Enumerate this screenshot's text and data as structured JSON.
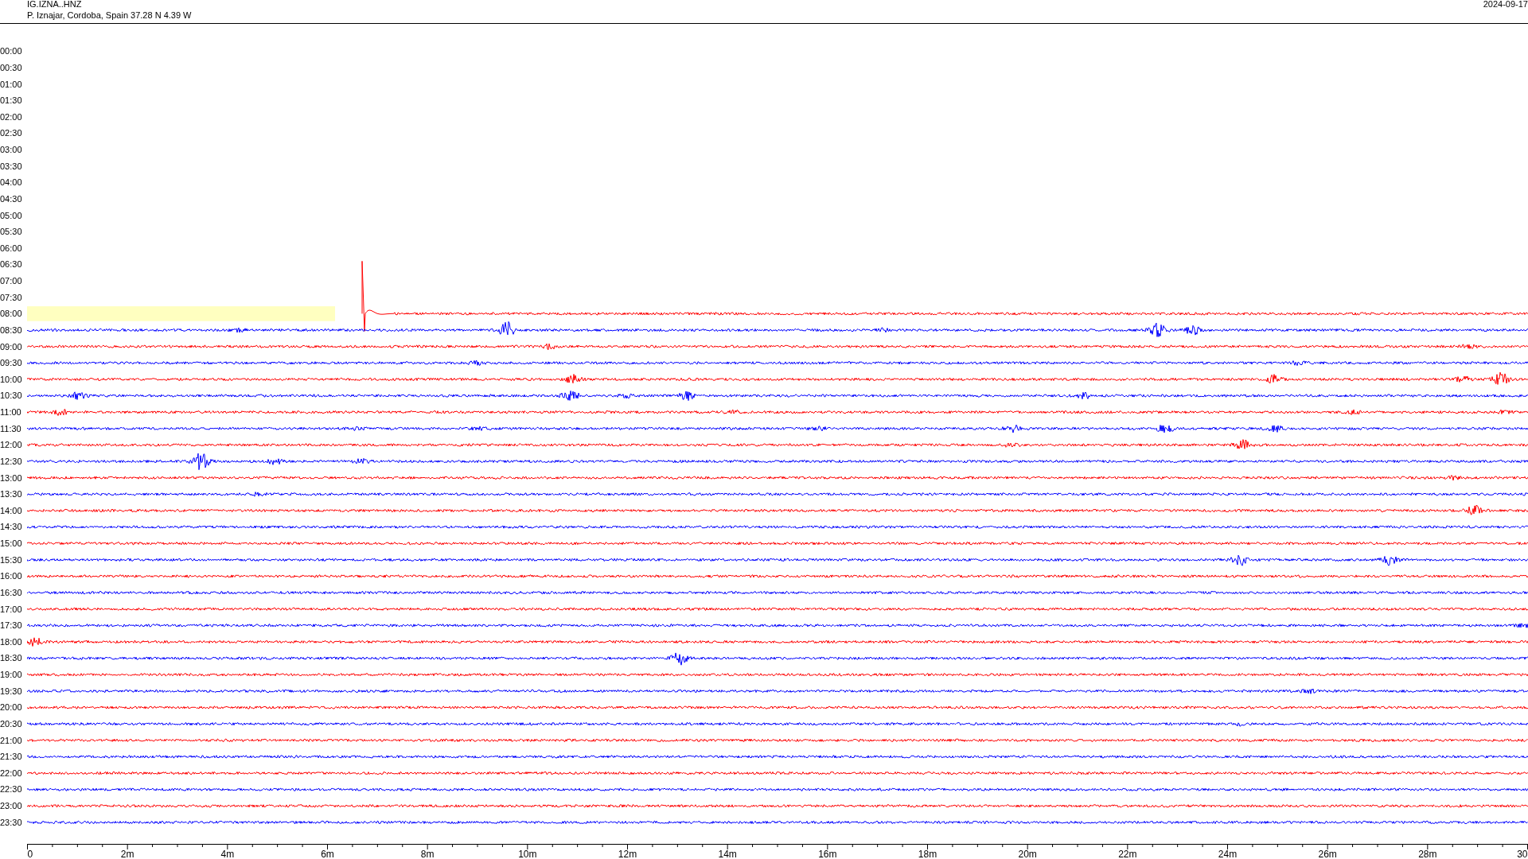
{
  "header": {
    "station": "IG.IZNA..HNZ",
    "location": "P. Iznajar, Cordoba, Spain  37.28 N 4.39 W",
    "date": "2024-09-17"
  },
  "rows": [
    {
      "time": "00:00"
    },
    {
      "time": "00:30"
    },
    {
      "time": "01:00"
    },
    {
      "time": "01:30"
    },
    {
      "time": "02:00"
    },
    {
      "time": "02:30"
    },
    {
      "time": "03:00"
    },
    {
      "time": "03:30"
    },
    {
      "time": "04:00"
    },
    {
      "time": "04:30"
    },
    {
      "time": "05:00"
    },
    {
      "time": "05:30"
    },
    {
      "time": "06:00"
    },
    {
      "time": "06:30"
    },
    {
      "time": "07:00"
    },
    {
      "time": "07:30"
    },
    {
      "time": "08:00",
      "color": "#ff0000",
      "highlighted": true
    },
    {
      "time": "08:30",
      "color": "#0000ff"
    },
    {
      "time": "09:00",
      "color": "#ff0000"
    },
    {
      "time": "09:30",
      "color": "#0000ff"
    },
    {
      "time": "10:00",
      "color": "#ff0000"
    },
    {
      "time": "10:30",
      "color": "#0000ff"
    },
    {
      "time": "11:00",
      "color": "#ff0000"
    },
    {
      "time": "11:30",
      "color": "#0000ff"
    },
    {
      "time": "12:00",
      "color": "#ff0000"
    },
    {
      "time": "12:30",
      "color": "#0000ff"
    },
    {
      "time": "13:00",
      "color": "#ff0000"
    },
    {
      "time": "13:30",
      "color": "#0000ff"
    },
    {
      "time": "14:00",
      "color": "#ff0000"
    },
    {
      "time": "14:30",
      "color": "#0000ff"
    },
    {
      "time": "15:00",
      "color": "#ff0000"
    },
    {
      "time": "15:30",
      "color": "#0000ff"
    },
    {
      "time": "16:00",
      "color": "#ff0000"
    },
    {
      "time": "16:30",
      "color": "#0000ff"
    },
    {
      "time": "17:00",
      "color": "#ff0000"
    },
    {
      "time": "17:30",
      "color": "#0000ff"
    },
    {
      "time": "18:00",
      "color": "#ff0000"
    },
    {
      "time": "18:30",
      "color": "#0000ff"
    },
    {
      "time": "19:00",
      "color": "#ff0000"
    },
    {
      "time": "19:30",
      "color": "#0000ff"
    },
    {
      "time": "20:00",
      "color": "#ff0000"
    },
    {
      "time": "20:30",
      "color": "#0000ff"
    },
    {
      "time": "21:00",
      "color": "#ff0000"
    },
    {
      "time": "21:30",
      "color": "#0000ff"
    },
    {
      "time": "22:00",
      "color": "#ff0000"
    },
    {
      "time": "22:30",
      "color": "#0000ff"
    },
    {
      "time": "23:00",
      "color": "#ff0000"
    },
    {
      "time": "23:30",
      "color": "#0000ff"
    }
  ],
  "x_axis": {
    "labels": [
      "0",
      "2m",
      "4m",
      "6m",
      "8m",
      "10m",
      "12m",
      "14m",
      "16m",
      "18m",
      "20m",
      "22m",
      "24m",
      "26m",
      "28m",
      "30"
    ]
  }
}
